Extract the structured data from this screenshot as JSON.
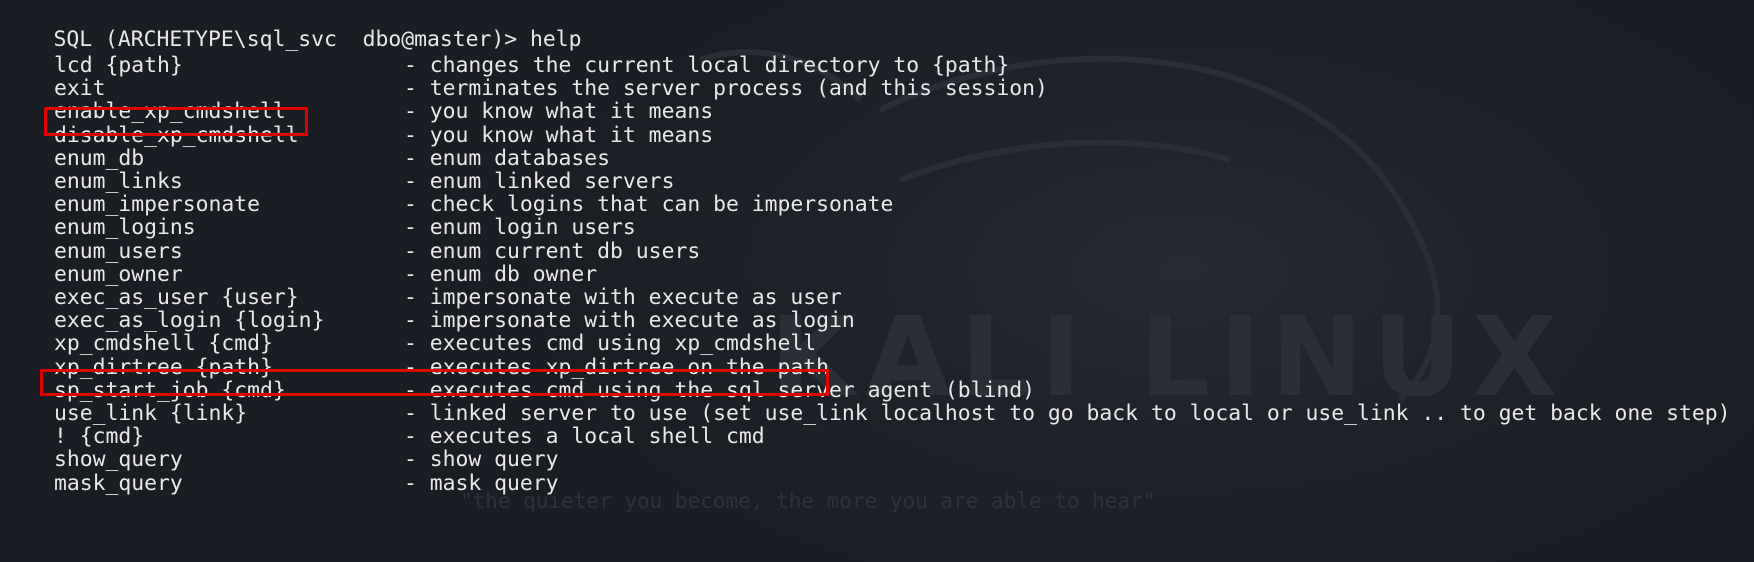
{
  "prompt": {
    "text": "SQL (ARCHETYPE\\sql_svc  dbo@master)> ",
    "command": "help"
  },
  "help_entries": [
    {
      "command": "lcd {path}",
      "description": "- changes the current local directory to {path}"
    },
    {
      "command": "exit",
      "description": "- terminates the server process (and this session)"
    },
    {
      "command": "enable_xp_cmdshell",
      "description": "- you know what it means"
    },
    {
      "command": "disable_xp_cmdshell",
      "description": "- you know what it means"
    },
    {
      "command": "enum_db",
      "description": "- enum databases"
    },
    {
      "command": "enum_links",
      "description": "- enum linked servers"
    },
    {
      "command": "enum_impersonate",
      "description": "- check logins that can be impersonate"
    },
    {
      "command": "enum_logins",
      "description": "- enum login users"
    },
    {
      "command": "enum_users",
      "description": "- enum current db users"
    },
    {
      "command": "enum_owner",
      "description": "- enum db owner"
    },
    {
      "command": "exec_as_user {user}",
      "description": "- impersonate with execute as user"
    },
    {
      "command": "exec_as_login {login}",
      "description": "- impersonate with execute as login"
    },
    {
      "command": "xp_cmdshell {cmd}",
      "description": "- executes cmd using xp_cmdshell"
    },
    {
      "command": "xp_dirtree {path}",
      "description": "- executes xp_dirtree on the path"
    },
    {
      "command": "sp_start_job {cmd}",
      "description": "- executes cmd using the sql server agent (blind)"
    },
    {
      "command": "use_link {link}",
      "description": "- linked server to use (set use_link localhost to go back to local or use_link .. to get back one step)"
    },
    {
      "command": "! {cmd}",
      "description": "- executes a local shell cmd"
    },
    {
      "command": "show_query",
      "description": "- show query"
    },
    {
      "command": "mask_query",
      "description": "- mask query"
    }
  ],
  "highlights": [
    {
      "target": "enable_xp_cmdshell",
      "color": "#e10000"
    },
    {
      "target": "xp_cmdshell {cmd}",
      "color": "#e10000"
    }
  ],
  "watermark": {
    "wordmark": "KALI LINUX",
    "tagline": "\"the quieter you become, the more you are able to hear\""
  },
  "colors": {
    "background": "#1b1e25",
    "text": "#e8e8e8",
    "highlight": "#e10000"
  }
}
